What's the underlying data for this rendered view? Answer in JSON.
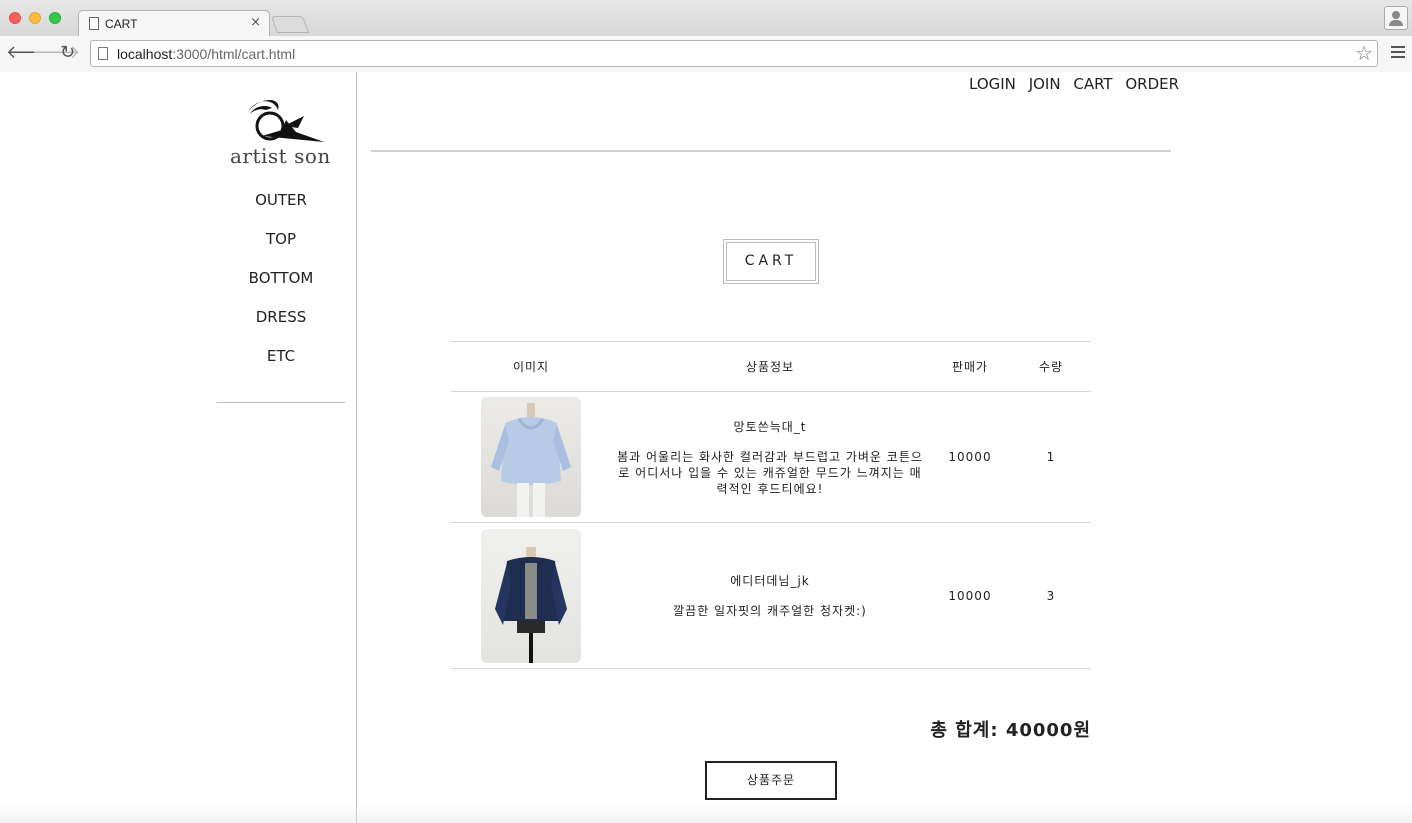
{
  "browser": {
    "tab_title": "CART",
    "tab_close": "×",
    "url_host": "localhost",
    "url_path": ":3000/html/cart.html"
  },
  "sidebar": {
    "logo_text": "artist son",
    "categories": [
      "OUTER",
      "TOP",
      "BOTTOM",
      "DRESS",
      "ETC"
    ]
  },
  "topnav": {
    "login": "LOGIN",
    "join": "JOIN",
    "cart": "CART",
    "order": "ORDER"
  },
  "cart": {
    "title": "CART",
    "headers": {
      "image": "이미지",
      "info": "상품정보",
      "price": "판매가",
      "qty": "수량"
    },
    "items": [
      {
        "name": "망토쓴늑대_t",
        "description": "봄과 어울리는 화사한 컬러감과 부드럽고 가벼운 코튼으로 어디서나 입을 수 있는 캐쥬얼한 무드가 느껴지는 매력적인 후드티에요!",
        "price": "10000",
        "qty": "1",
        "image_color": "#b7cbe6"
      },
      {
        "name": "에디터데님_jk",
        "description": "깔끔한 일자핏의 캐주얼한 청자켓:)",
        "price": "10000",
        "qty": "3",
        "image_color": "#1e2d50"
      }
    ],
    "total": "총 합계: 40000원",
    "order_button": "상품주문"
  }
}
